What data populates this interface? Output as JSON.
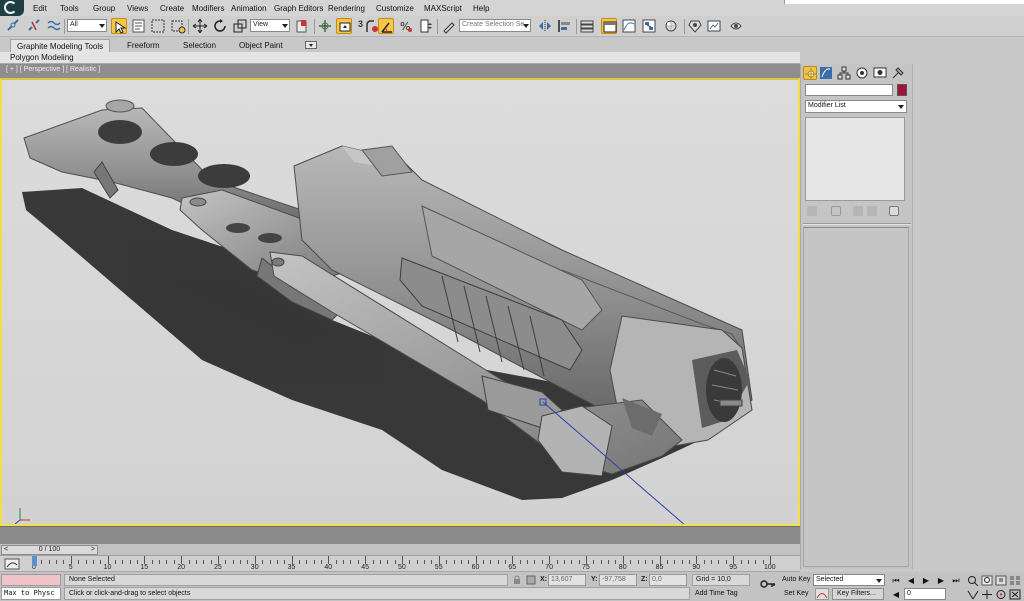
{
  "menubar": {
    "items": [
      "Edit",
      "Tools",
      "Group",
      "Views",
      "Create",
      "Modifiers",
      "Animation",
      "Graph Editors",
      "Rendering",
      "Customize",
      "MAXScript",
      "Help"
    ]
  },
  "toolbar": {
    "selection_filter": "All",
    "reference_coord": "View",
    "snap_number": "3",
    "named_selection_placeholder": "Create Selection Se"
  },
  "ribbon": {
    "tabs": [
      "Graphite Modeling Tools",
      "Freeform",
      "Selection",
      "Object Paint"
    ],
    "panel_label": "Polygon Modeling"
  },
  "viewport": {
    "label": "[ + ] [ Perspective ] [ Realistic ]"
  },
  "command_panel": {
    "modifier_list": "Modifier List",
    "object_color": "#a0163a"
  },
  "timeline": {
    "slider_text": "0 / 100",
    "prev": "<",
    "next": ">",
    "ruler_labels": [
      "0",
      "5",
      "10",
      "15",
      "20",
      "25",
      "30",
      "35",
      "40",
      "45",
      "50",
      "55",
      "60",
      "65",
      "70",
      "75",
      "80",
      "85",
      "90",
      "95",
      "100"
    ]
  },
  "status": {
    "maxscript": "Max to Physc",
    "selection": "None Selected",
    "prompt": "Click or click-and-drag to select objects",
    "x_label": "X:",
    "x_value": "13,607",
    "y_label": "Y:",
    "y_value": "-97,758",
    "z_label": "Z:",
    "z_value": "0,0",
    "grid": "Grid = 10,0",
    "add_time_tag": "Add Time Tag",
    "auto_key": "Auto Key",
    "set_key": "Set Key",
    "key_mode": "Selected",
    "key_filters": "Key Filters...",
    "frame": "0"
  }
}
